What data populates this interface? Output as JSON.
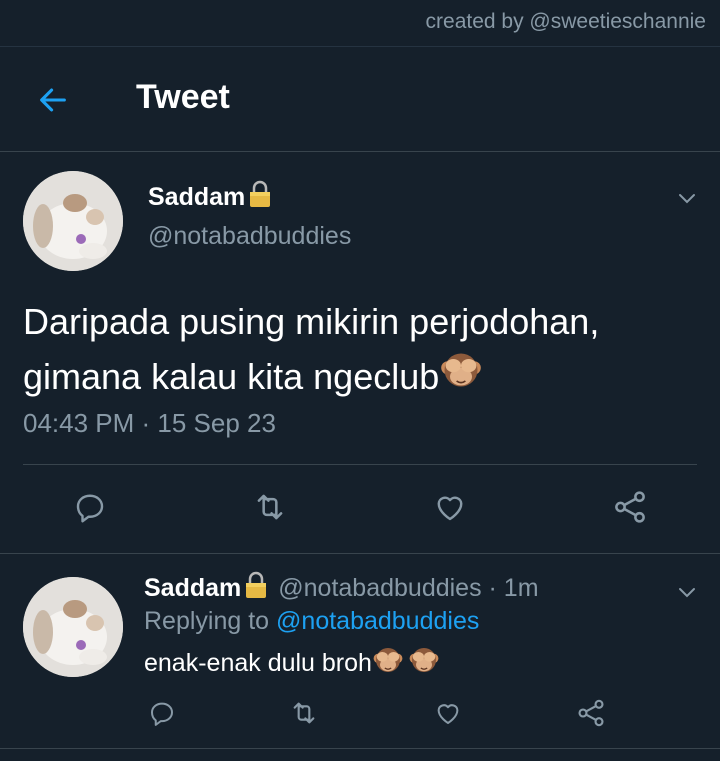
{
  "watermark": "created by @sweetieschannie",
  "header": {
    "title": "Tweet",
    "back_icon": "arrow-left-icon"
  },
  "colors": {
    "background": "#15202b",
    "accent": "#1da1f2",
    "secondary_text": "#8899a6",
    "divider": "#38444d"
  },
  "main_tweet": {
    "display_name": "Saddam",
    "handle": "@notabadbuddies",
    "text_line1": "Daripada pusing mikirin perjodohan,",
    "text_line2": "gimana kalau kita ngeclub",
    "emoji": "see-no-evil-monkey",
    "timestamp": "04:43 PM · 15 Sep 23"
  },
  "reply_tweet": {
    "display_name": "Saddam",
    "handle_time": "@notabadbuddies · 1m",
    "replying_prefix": "Replying to",
    "replying_to": "@notabadbuddies",
    "text": "enak-enak dulu broh"
  }
}
